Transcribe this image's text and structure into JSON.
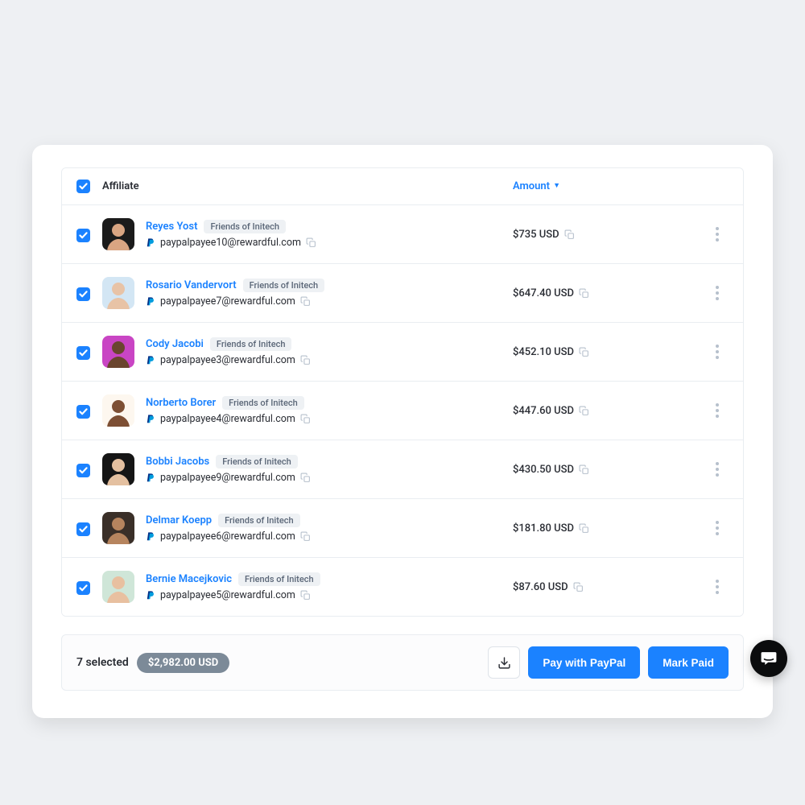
{
  "table": {
    "header": {
      "affiliate": "Affiliate",
      "amount": "Amount"
    },
    "sort_indicator": "▼"
  },
  "rows": [
    {
      "name": "Reyes Yost",
      "badge": "Friends of Initech",
      "email": "paypalpayee10@rewardful.com",
      "amount": "$735 USD",
      "avatar": {
        "bg": "#1b1b1b",
        "skin": "#d9a582"
      }
    },
    {
      "name": "Rosario Vandervort",
      "badge": "Friends of Initech",
      "email": "paypalpayee7@rewardful.com",
      "amount": "$647.40 USD",
      "avatar": {
        "bg": "#d3e6f4",
        "skin": "#e8c3a6"
      }
    },
    {
      "name": "Cody Jacobi",
      "badge": "Friends of Initech",
      "email": "paypalpayee3@rewardful.com",
      "amount": "$452.10 USD",
      "avatar": {
        "bg": "#c945c4",
        "skin": "#6a452e"
      }
    },
    {
      "name": "Norberto Borer",
      "badge": "Friends of Initech",
      "email": "paypalpayee4@rewardful.com",
      "amount": "$447.60 USD",
      "avatar": {
        "bg": "#fdf7ef",
        "skin": "#7d4f34"
      }
    },
    {
      "name": "Bobbi Jacobs",
      "badge": "Friends of Initech",
      "email": "paypalpayee9@rewardful.com",
      "amount": "$430.50 USD",
      "avatar": {
        "bg": "#151515",
        "skin": "#e4c0a0"
      }
    },
    {
      "name": "Delmar Koepp",
      "badge": "Friends of Initech",
      "email": "paypalpayee6@rewardful.com",
      "amount": "$181.80 USD",
      "avatar": {
        "bg": "#3a2f28",
        "skin": "#b6845e"
      }
    },
    {
      "name": "Bernie Macejkovic",
      "badge": "Friends of Initech",
      "email": "paypalpayee5@rewardful.com",
      "amount": "$87.60 USD",
      "avatar": {
        "bg": "#cfe6d8",
        "skin": "#e8c0a0"
      }
    }
  ],
  "footer": {
    "selected": "7 selected",
    "total": "$2,982.00 USD",
    "pay_paypal": "Pay with PayPal",
    "mark_paid": "Mark Paid"
  }
}
